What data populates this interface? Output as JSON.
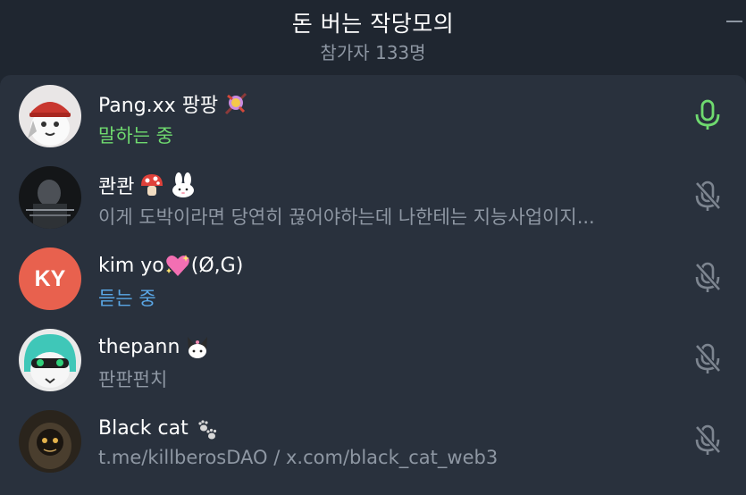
{
  "header": {
    "title": "돈 버는 작당모의",
    "subtitle": "참가자 133명"
  },
  "participants": [
    {
      "name": "Pang.xx 팡팡",
      "status": "말하는 중",
      "status_type": "speaking",
      "mic": "mic-on"
    },
    {
      "name": "콴콴",
      "status": "이게 도박이라면 당연히 끊어야하는데 나한테는 지능사업이지...",
      "status_type": "bio",
      "mic": "mic-muted"
    },
    {
      "name": "kim yo",
      "name_suffix": "(Ø,G)",
      "initials": "KY",
      "status": "듣는 중",
      "status_type": "listening",
      "mic": "mic-muted"
    },
    {
      "name": "thepann",
      "status": "판판펀치",
      "status_type": "bio",
      "mic": "mic-muted"
    },
    {
      "name": "Black cat",
      "status": "t.me/killberosDAO / x.com/black_cat_web3",
      "status_type": "bio",
      "mic": "mic-muted"
    }
  ],
  "colors": {
    "background": "#1f2630",
    "panel": "#29313d",
    "speaking": "#6fda6f",
    "listening": "#5aa7e6",
    "muted_icon": "#7d8590",
    "avatar_ky": "#e8614e"
  }
}
